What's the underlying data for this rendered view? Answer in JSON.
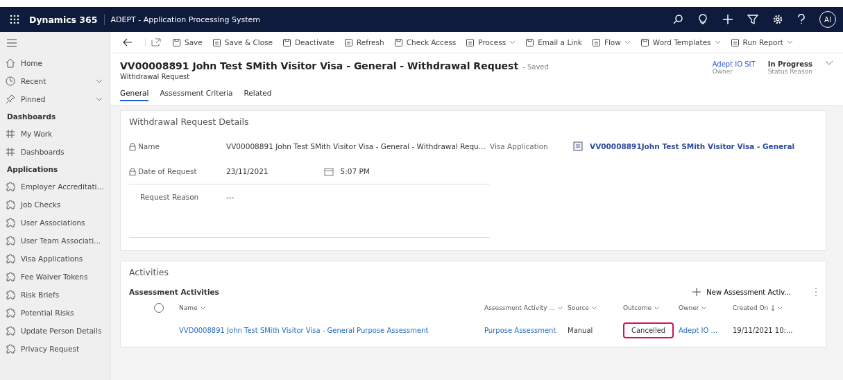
{
  "top_bar": {
    "app_name": "Dynamics 365",
    "app_title": "ADEPT - Application Processing System",
    "avatar": "AI"
  },
  "sidebar": {
    "top_items": [
      {
        "label": "Home",
        "expandable": false
      },
      {
        "label": "Recent",
        "expandable": true
      },
      {
        "label": "Pinned",
        "expandable": true
      }
    ],
    "sections": [
      {
        "heading": "Dashboards",
        "items": [
          "My Work",
          "Dashboards"
        ]
      },
      {
        "heading": "Applications",
        "items": [
          "Employer Accreditati...",
          "Job Checks",
          "User Associations",
          "User Team Associati...",
          "Visa Applications",
          "Fee Waiver Tokens",
          "Risk Briefs",
          "Potential Risks",
          "Update Person Details",
          "Privacy Request"
        ]
      }
    ]
  },
  "command_bar": [
    {
      "label": "Save",
      "dropdown": false
    },
    {
      "label": "Save & Close",
      "dropdown": false
    },
    {
      "label": "Deactivate",
      "dropdown": false
    },
    {
      "label": "Refresh",
      "dropdown": false
    },
    {
      "label": "Check Access",
      "dropdown": false
    },
    {
      "label": "Process",
      "dropdown": true
    },
    {
      "label": "Email a Link",
      "dropdown": false
    },
    {
      "label": "Flow",
      "dropdown": true
    },
    {
      "label": "Word Templates",
      "dropdown": true
    },
    {
      "label": "Run Report",
      "dropdown": true
    }
  ],
  "header": {
    "title": "VV00008891 John Test SMith Visitor Visa - General - Withdrawal Request",
    "save_state": "- Saved",
    "entity": "Withdrawal Request",
    "fields": [
      {
        "value": "Adept IO SIT",
        "label": "Owner",
        "kind": "link"
      },
      {
        "value": "In Progress",
        "label": "Status Reason",
        "kind": "text"
      }
    ]
  },
  "tabs": [
    {
      "label": "General",
      "selected": true
    },
    {
      "label": "Assessment Criteria",
      "selected": false
    },
    {
      "label": "Related",
      "selected": false
    }
  ],
  "details": {
    "title": "Withdrawal Request Details",
    "fields": [
      {
        "label": "Name",
        "locked": true,
        "value": "VV00008891 John Test SMith Visitor Visa - General - Withdrawal Requ..."
      },
      {
        "label": "Date of Request",
        "locked": true,
        "value": "23/11/2021",
        "time": "5:07 PM"
      },
      {
        "label": "Request Reason",
        "locked": false,
        "value": "---"
      }
    ],
    "lookup": {
      "label": "Visa Application",
      "value": "VV00008891John Test SMith Visitor Visa - General"
    }
  },
  "activities": {
    "title": "Activities",
    "subgrid_title": "Assessment Activities",
    "new_button": "New Assessment Activ...",
    "select_all_checked": false,
    "columns": [
      "Name",
      "Assessment Activity ...",
      "Source",
      "Outcome",
      "Owner",
      "Created On"
    ],
    "rows": [
      {
        "selected": false,
        "cells": [
          {
            "text": "VVD0008891 John Test SMith Visitor Visa - General Purpose Assessment",
            "kind": "link",
            "highlighted": false
          },
          {
            "text": "Purpose Assessment",
            "kind": "link",
            "highlighted": false
          },
          {
            "text": "Manual",
            "kind": "text",
            "highlighted": false
          },
          {
            "text": "Cancelled",
            "kind": "text",
            "highlighted": true
          },
          {
            "text": "Adept IO ...",
            "kind": "link",
            "highlighted": false
          },
          {
            "text": "19/11/2021 10:...",
            "kind": "text",
            "highlighted": false
          }
        ]
      }
    ]
  }
}
